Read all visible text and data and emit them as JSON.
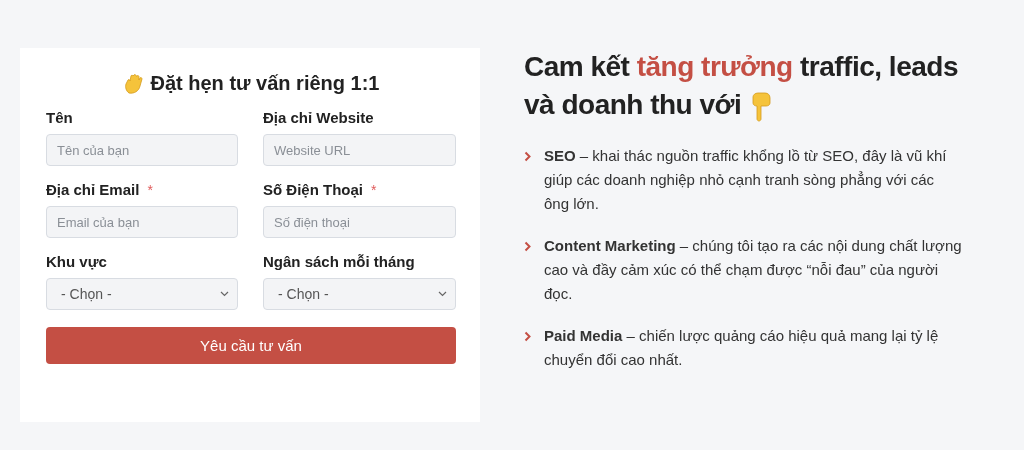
{
  "form": {
    "title": "Đặt hẹn tư vấn riêng 1:1",
    "fields": [
      {
        "kind": "input",
        "label": "Tên",
        "placeholder": "Tên của bạn"
      },
      {
        "kind": "input",
        "label": "Địa chỉ Website",
        "placeholder": "Website URL"
      },
      {
        "kind": "input",
        "label": "Địa chỉ Email",
        "required_marker": "*",
        "placeholder": "Email của bạn"
      },
      {
        "kind": "input",
        "label": "Số Điện Thoại",
        "required_marker": "*",
        "placeholder": "Số điện thoại"
      },
      {
        "kind": "select",
        "label": "Khu vực",
        "value": "- Chọn -"
      },
      {
        "kind": "select",
        "label": "Ngân sách mỗi tháng",
        "value": "- Chọn -"
      }
    ],
    "submit": "Yêu cầu tư vấn"
  },
  "benefits": {
    "heading_lines": [
      "Cam kết *tăng trưởng* traffic, leads",
      "và doanh thu với"
    ],
    "items": [
      "**SEO** – khai thác nguồn traffic khổng lồ từ SEO, đây là vũ khí giúp các doanh nghiệp nhỏ cạnh tranh sòng phẳng với các ông lớn.",
      "**Content Marketing** – chúng tôi tạo ra các nội dung chất lượng cao và đầy cảm xúc có thể chạm được “nỗi đau” của người đọc.",
      "**Paid Media** – chiến lược quảng cáo hiệu quả mang lại tỷ lệ chuyển đổi cao nhất."
    ]
  }
}
